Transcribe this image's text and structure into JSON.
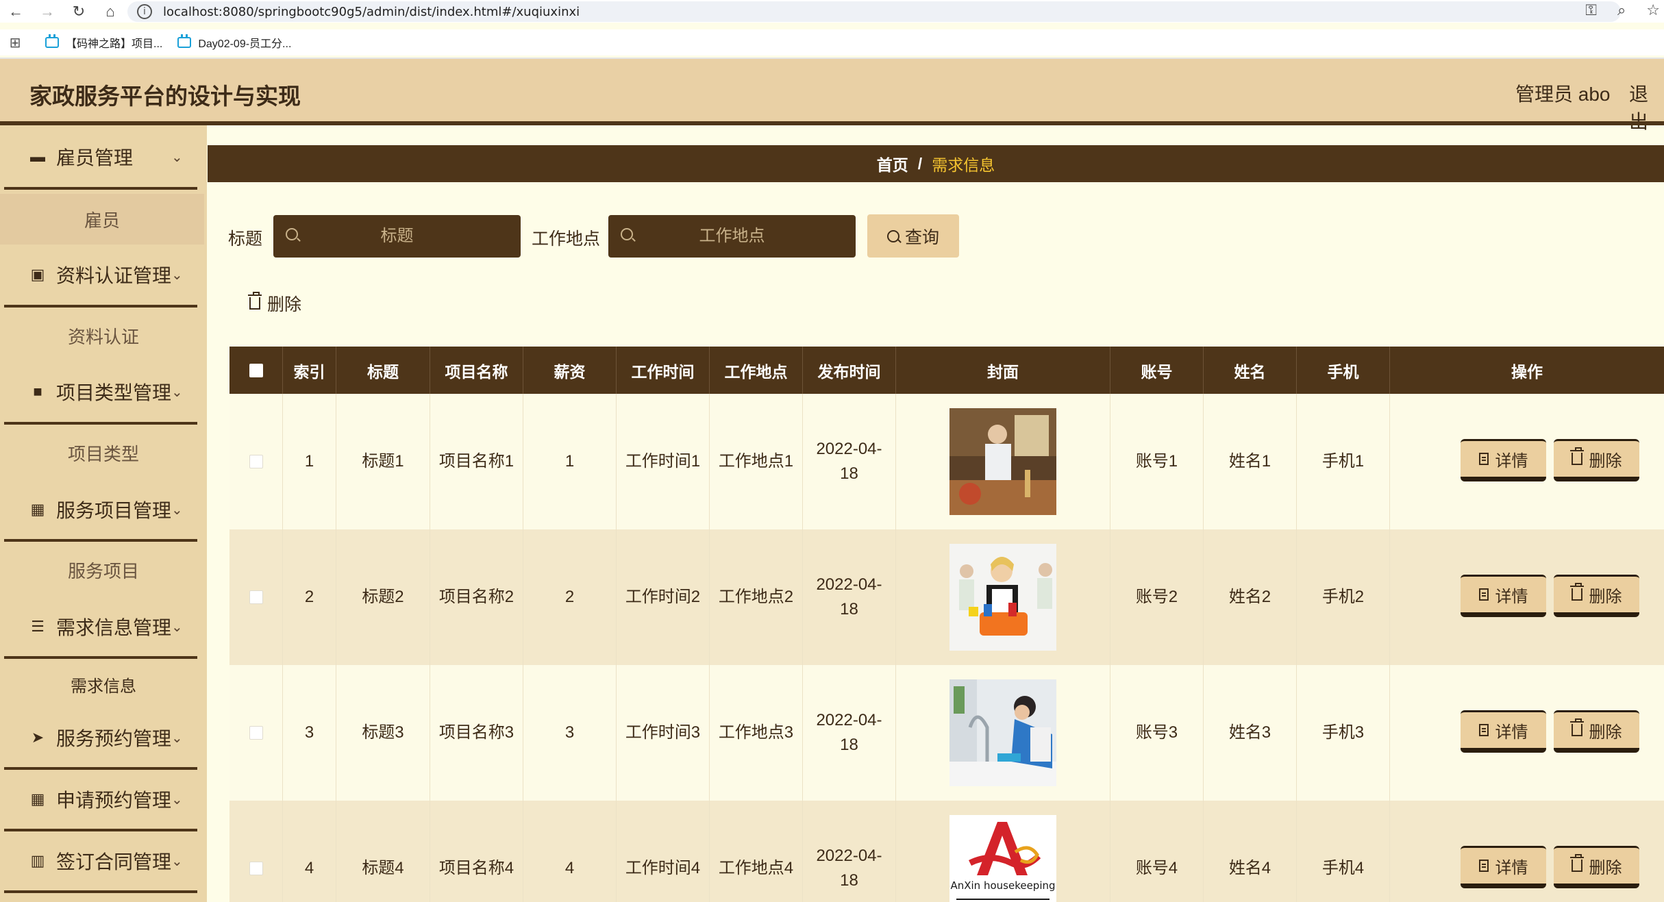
{
  "browser": {
    "url": "localhost:8080/springbootc90g5/admin/dist/index.html#/xuqiuxinxi",
    "bookmarks": [
      "【码神之路】项目...",
      "Day02-09-员工分..."
    ]
  },
  "app": {
    "title": "家政服务平台的设计与实现",
    "user": "管理员 abo",
    "logout": "退出"
  },
  "sidebar": {
    "groups": [
      {
        "label": "雇员管理",
        "icon": "briefcase-icon",
        "sub": "雇员"
      },
      {
        "label": "资料认证管理",
        "icon": "clipboard-check-icon",
        "sub": "资料认证"
      },
      {
        "label": "项目类型管理",
        "icon": "video-icon",
        "sub": "项目类型"
      },
      {
        "label": "服务项目管理",
        "icon": "grid-icon",
        "sub": "服务项目"
      },
      {
        "label": "需求信息管理",
        "icon": "list-icon",
        "sub": "需求信息"
      },
      {
        "label": "服务预约管理",
        "icon": "send-icon"
      },
      {
        "label": "申请预约管理",
        "icon": "grid-icon"
      },
      {
        "label": "签订合同管理",
        "icon": "bar-chart-icon"
      }
    ]
  },
  "breadcrumb": {
    "home": "首页",
    "sep": "/",
    "current": "需求信息"
  },
  "search": {
    "title_label": "标题",
    "title_placeholder": "标题",
    "location_label": "工作地点",
    "location_placeholder": "工作地点",
    "query_label": "查询"
  },
  "actions": {
    "batch_delete": "删除"
  },
  "table": {
    "headers": [
      "索引",
      "标题",
      "项目名称",
      "薪资",
      "工作时间",
      "工作地点",
      "发布时间",
      "封面",
      "账号",
      "姓名",
      "手机",
      "操作"
    ],
    "detail_label": "详情",
    "delete_label": "删除",
    "rows": [
      {
        "index": "1",
        "title": "标题1",
        "project": "项目名称1",
        "salary": "1",
        "work_time": "工作时间1",
        "location": "工作地点1",
        "publish_l1": "2022-04-",
        "publish_l2": "18",
        "account": "账号1",
        "name": "姓名1",
        "phone": "手机1"
      },
      {
        "index": "2",
        "title": "标题2",
        "project": "项目名称2",
        "salary": "2",
        "work_time": "工作时间2",
        "location": "工作地点2",
        "publish_l1": "2022-04-",
        "publish_l2": "18",
        "account": "账号2",
        "name": "姓名2",
        "phone": "手机2"
      },
      {
        "index": "3",
        "title": "标题3",
        "project": "项目名称3",
        "salary": "3",
        "work_time": "工作时间3",
        "location": "工作地点3",
        "publish_l1": "2022-04-",
        "publish_l2": "18",
        "account": "账号3",
        "name": "姓名3",
        "phone": "手机3"
      },
      {
        "index": "4",
        "title": "标题4",
        "project": "项目名称4",
        "salary": "4",
        "work_time": "工作时间4",
        "location": "工作地点4",
        "publish_l1": "2022-04-",
        "publish_l2": "18",
        "account": "账号4",
        "name": "姓名4",
        "phone": "手机4"
      }
    ],
    "cover4_logo_text": "AnXin housekeeping"
  },
  "colors": {
    "header": "#e9d0a5",
    "dark": "#4e3519",
    "accent": "#f6c530",
    "page": "#fefde8"
  }
}
